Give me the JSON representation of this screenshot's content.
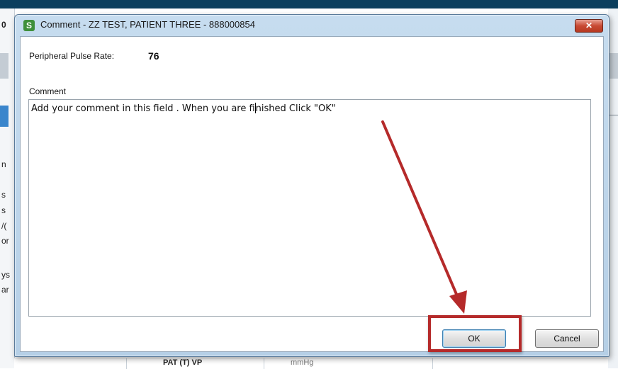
{
  "background": {
    "fragments": [
      "n",
      "s",
      "s",
      "/(",
      "or",
      "ys",
      "ar"
    ],
    "bottom_text": "PAT (T) VP",
    "bottom_unit": "mmHg"
  },
  "dialog": {
    "icon_letter": "S",
    "title": "Comment - ZZ TEST, PATIENT THREE - 888000854",
    "close_glyph": "✕",
    "pulse_label": "Peripheral Pulse Rate:",
    "pulse_value": "76",
    "comment_label": "Comment",
    "comment_before_caret": "Add your comment in this field . When you are fi",
    "comment_after_caret": "nished Click \"OK\"",
    "ok_label": "OK",
    "cancel_label": "Cancel"
  },
  "annotation": {
    "color": "#b52a2a"
  },
  "colors": {
    "titlebar_dark": "#0c3f5e",
    "dialog_frame": "#b5cfe6",
    "close_button": "#c84a34"
  }
}
